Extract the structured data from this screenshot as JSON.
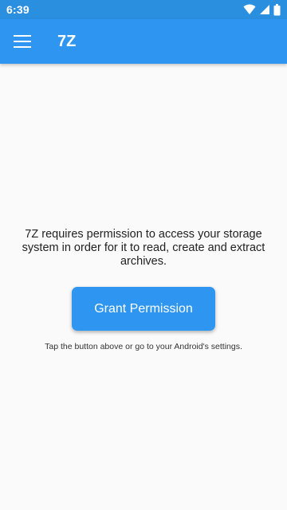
{
  "status_bar": {
    "time": "6:39",
    "icons": [
      "wifi-icon",
      "signal-icon",
      "battery-icon"
    ]
  },
  "app_bar": {
    "menu_icon": "hamburger-menu-icon",
    "title": "7Z"
  },
  "main": {
    "message": "7Z requires permission to access your storage system in order for it to read, create and extract archives.",
    "grant_button_label": "Grant Permission",
    "hint": "Tap the button above or go to your Android's settings."
  },
  "colors": {
    "primary": "#2e96f0",
    "status_bar": "#2b8fe0",
    "background": "#fafafa",
    "text": "#222222"
  }
}
